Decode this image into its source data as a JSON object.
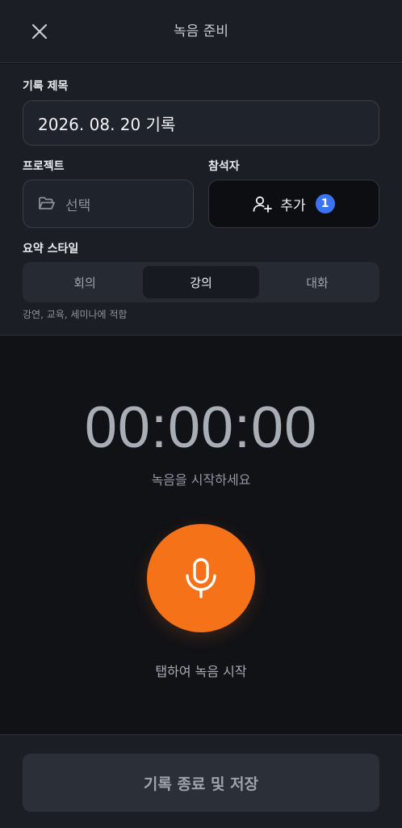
{
  "header": {
    "title": "녹음 준비",
    "close_icon": "close-icon"
  },
  "form": {
    "record_title_label": "기록 제목",
    "record_title_value": "2026. 08. 20 기록",
    "project_label": "프로젝트",
    "project_placeholder": "선택",
    "participants_label": "참석자",
    "add_label": "추가",
    "participant_count": "1",
    "summary_style_label": "요약 스타일",
    "styles": [
      "회의",
      "강의",
      "대화"
    ],
    "selected_style": "강의",
    "style_hint": "강연, 교육, 세미나에 적합"
  },
  "recorder": {
    "timer": "00:00:00",
    "status": "녹음을 시작하세요",
    "tap_hint": "탭하여 녹음 시작"
  },
  "footer": {
    "save_label": "기록 종료 및 저장"
  },
  "colors": {
    "accent": "#f57219",
    "badge": "#3b74f2",
    "panel": "#1b1e25",
    "background": "#111216"
  }
}
